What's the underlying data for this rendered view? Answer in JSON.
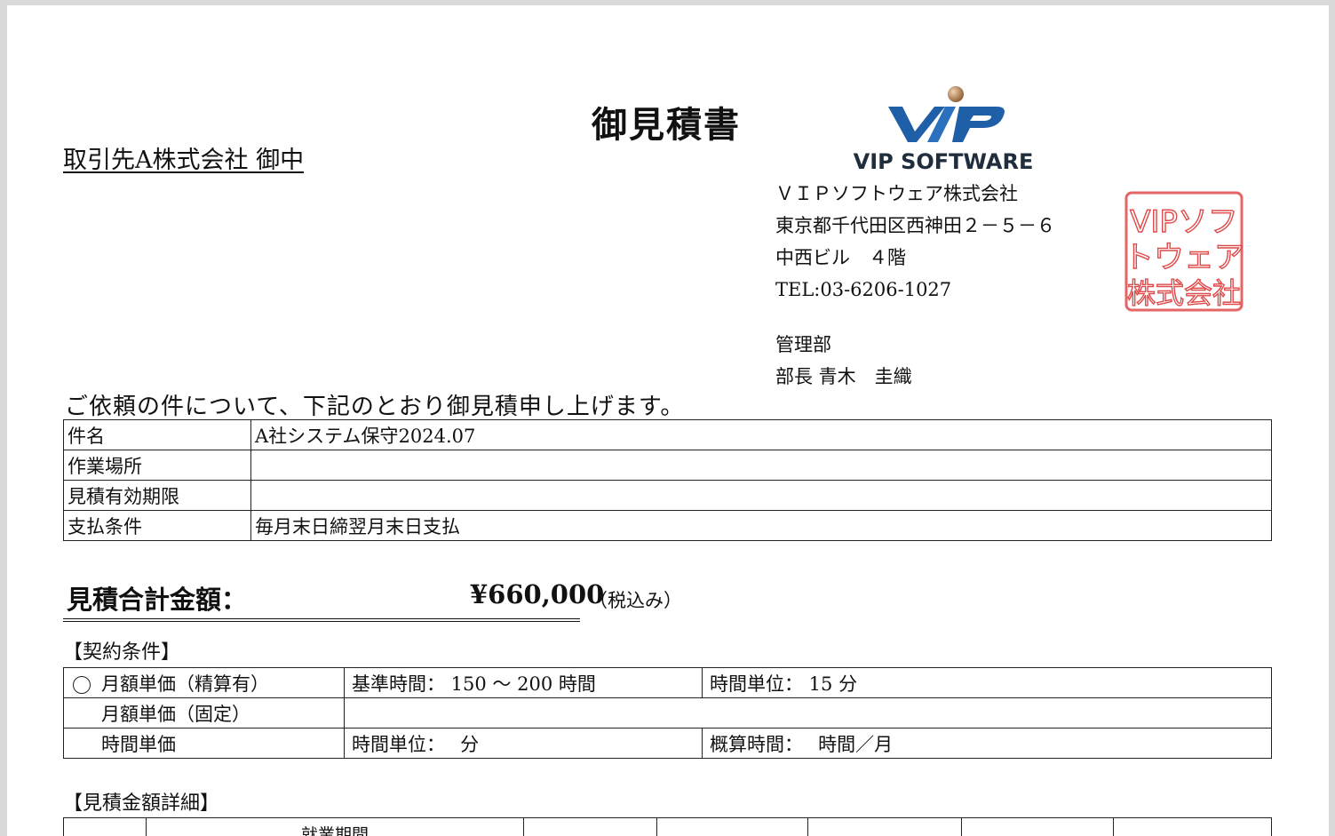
{
  "document": {
    "title": "御見積書",
    "client": "取引先A株式会社 御中",
    "intro": "ご依頼の件について、下記のとおり御見積申し上げます。"
  },
  "issuer": {
    "logo_text": "VIP SOFTWARE",
    "name": "ＶＩＰソフトウェア株式会社",
    "address1": "東京都千代田区西神田２－５－６",
    "address2": "中西ビル　４階",
    "tel": "TEL:03-6206-1027",
    "department": "管理部",
    "person": "部長 青木　圭織",
    "seal_text": "VIPソフトウェア株式会社"
  },
  "info_table": [
    {
      "label": "件名",
      "value": "A社システム保守2024.07"
    },
    {
      "label": "作業場所",
      "value": ""
    },
    {
      "label": "見積有効期限",
      "value": ""
    },
    {
      "label": "支払条件",
      "value": "毎月末日締翌月末日支払"
    }
  ],
  "total": {
    "label": "見積合計金額：",
    "amount": "¥660,000",
    "note": "（税込み）"
  },
  "contract": {
    "heading": "【契約条件】",
    "rows": [
      {
        "selected": true,
        "type": "月額単価（精算有）",
        "col2": "基準時間： 150 ～ 200 時間",
        "col3": "時間単位： 15 分"
      },
      {
        "selected": false,
        "type": "月額単価（固定）",
        "col2": "",
        "col3": ""
      },
      {
        "selected": false,
        "type": "時間単価",
        "col2": "時間単位：　 分",
        "col3": "概算時間：　 時間／月"
      }
    ]
  },
  "detail": {
    "heading": "【見積金額詳細】",
    "period_header": "就業期間"
  },
  "colors": {
    "logo_blue": "#1e5fa8",
    "logo_dark": "#1f2d3d",
    "logo_bronze": "#b07a4a",
    "seal_red": "#e04a4a"
  }
}
